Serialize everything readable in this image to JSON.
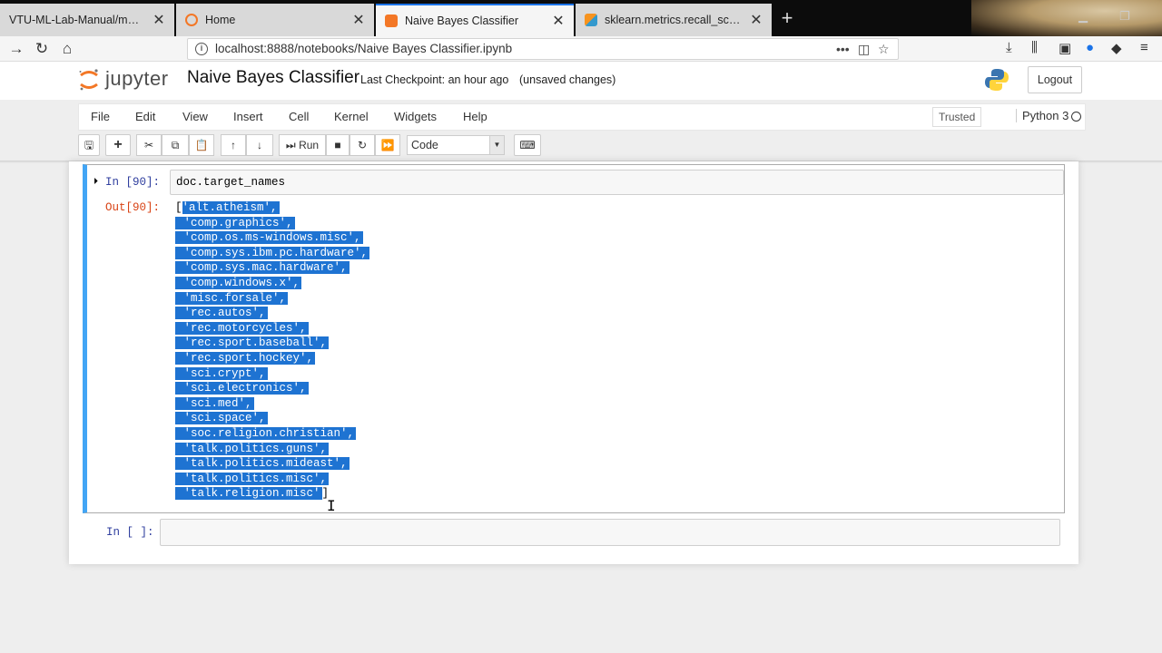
{
  "browser": {
    "tabs": [
      {
        "label": "VTU-ML-Lab-Manual/manual.",
        "active": false,
        "icon": "page-icon"
      },
      {
        "label": "Home",
        "active": false,
        "icon": "jupyter-icon"
      },
      {
        "label": "Naive Bayes Classifier",
        "active": true,
        "icon": "notebook-icon"
      },
      {
        "label": "sklearn.metrics.recall_score —",
        "active": false,
        "icon": "sklearn-icon"
      }
    ],
    "url": "localhost:8888/notebooks/Naive Bayes Classifier.ipynb"
  },
  "jupyter": {
    "brand": "jupyter",
    "notebook_title": "Naive Bayes Classifier",
    "checkpoint": "Last Checkpoint: an hour ago",
    "unsaved": "(unsaved changes)",
    "logout": "Logout",
    "menu": [
      "File",
      "Edit",
      "View",
      "Insert",
      "Cell",
      "Kernel",
      "Widgets",
      "Help"
    ],
    "trusted": "Trusted",
    "kernel": "Python 3",
    "toolbar": {
      "run_label": "Run",
      "cell_type": "Code"
    }
  },
  "cells": {
    "cell1": {
      "in_prompt": "In [90]:",
      "code": "doc.target_names",
      "out_prompt": "Out[90]:",
      "output_lines": [
        "'alt.atheism',",
        "'comp.graphics',",
        "'comp.os.ms-windows.misc',",
        "'comp.sys.ibm.pc.hardware',",
        "'comp.sys.mac.hardware',",
        "'comp.windows.x',",
        "'misc.forsale',",
        "'rec.autos',",
        "'rec.motorcycles',",
        "'rec.sport.baseball',",
        "'rec.sport.hockey',",
        "'sci.crypt',",
        "'sci.electronics',",
        "'sci.med',",
        "'sci.space',",
        "'soc.religion.christian',",
        "'talk.politics.guns',",
        "'talk.politics.mideast',",
        "'talk.politics.misc',",
        "'talk.religion.misc'"
      ]
    },
    "cell2": {
      "in_prompt": "In [ ]:"
    }
  },
  "colors": {
    "selected_cell_border": "#42a5f5",
    "selection": "#1e73d2",
    "in_prompt": "#303f9f",
    "out_prompt": "#d84315"
  }
}
